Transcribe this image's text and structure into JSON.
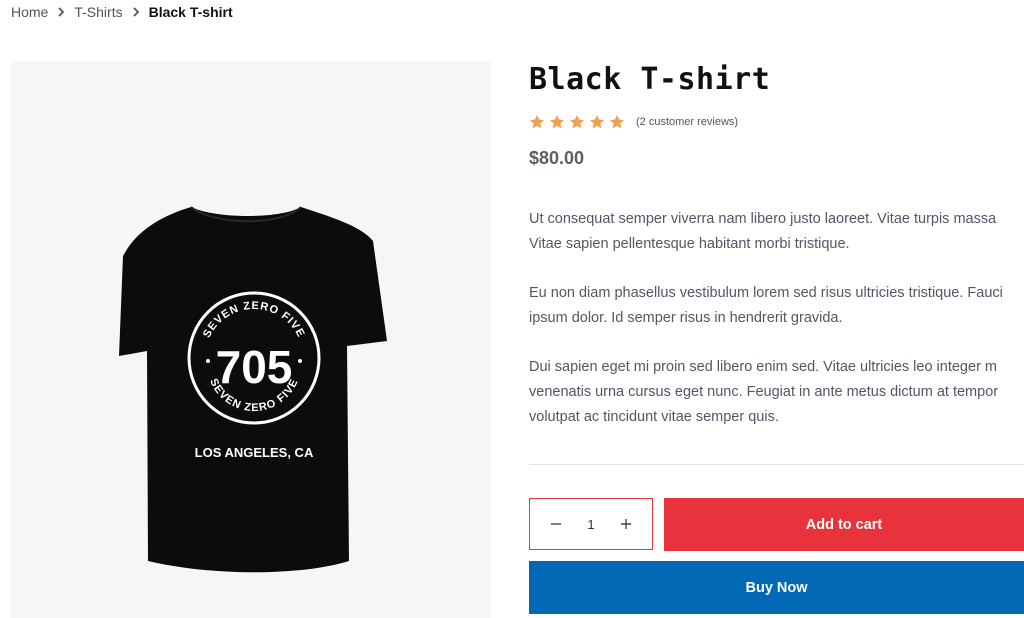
{
  "breadcrumb": {
    "items": [
      {
        "label": "Home"
      },
      {
        "label": "T-Shirts"
      }
    ],
    "current": "Black T-shirt",
    "separator_icon": "chevron-right-icon"
  },
  "product": {
    "title": "Black T-shirt",
    "rating": 5,
    "rating_max": 5,
    "reviews_text": "(2 customer reviews)",
    "price": "$80.00",
    "description": [
      "Ut consequat semper viverra nam libero justo laoreet. Vitae turpis massa",
      "Vitae sapien pellentesque habitant morbi tristique.",
      "Eu non diam phasellus vestibulum lorem sed risus ultricies tristique. Fauci",
      "ipsum dolor. Id semper risus in hendrerit gravida.",
      "Dui sapien eget mi proin sed libero enim sed. Vitae ultricies leo integer m",
      "venenatis urna cursus eget nunc. Feugiat in ante metus dictum at tempor",
      "volutpat ac tincidunt vitae semper quis."
    ],
    "image": {
      "shirt_top_text": "SEVEN ZERO FIVE",
      "shirt_number": "705",
      "shirt_bottom_text": "SEVEN ZERO FIVE",
      "shirt_city": "LOS ANGELES, CA"
    }
  },
  "quantity": {
    "value": "1",
    "decrease_icon": "minus-icon",
    "increase_icon": "plus-icon"
  },
  "buttons": {
    "add_to_cart": "Add to cart",
    "buy_now": "Buy Now"
  },
  "colors": {
    "star": "#f0a04b",
    "add_to_cart": "#e8323c",
    "buy_now": "#0068b5",
    "quantity_border": "#e23b3b",
    "image_bg": "#f6f6f6"
  }
}
